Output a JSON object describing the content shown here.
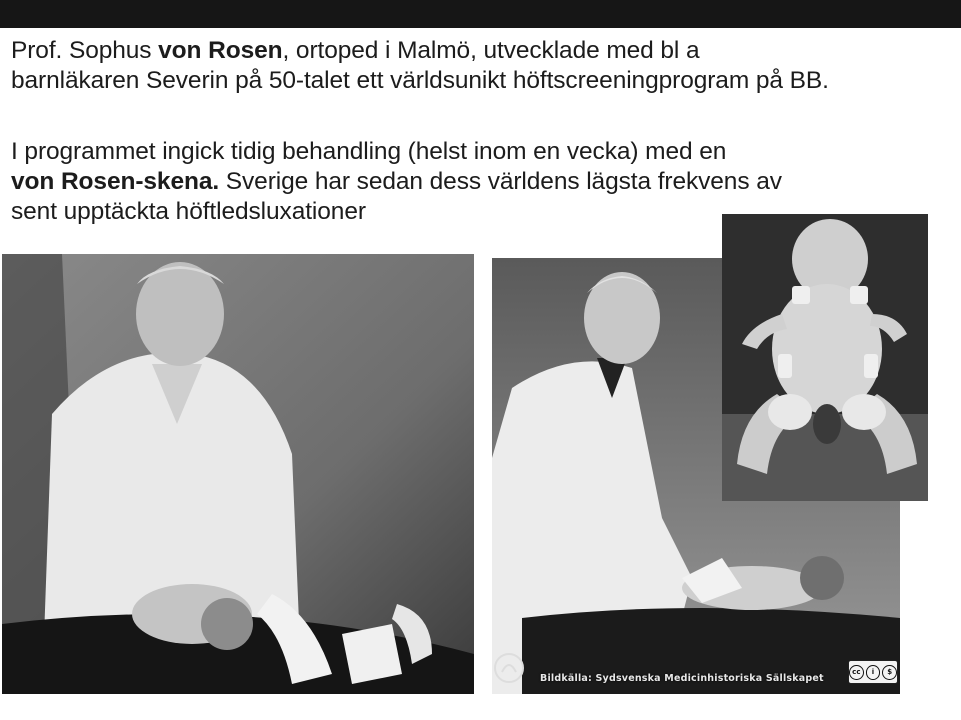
{
  "slide": {
    "paragraph1": {
      "before": "Prof. Sophus ",
      "bold": "von Rosen",
      "after": ", ortoped i Malmö, utvecklade med bl a\nbarnläkaren Severin på 50-talet ett världsunikt höftscreeningprogram på BB."
    },
    "paragraph2": {
      "before": "I programmet ingick tidig behandling (helst inom en vecka) med en\n",
      "bold": "von Rosen-skena.",
      "after": " Sverige har sedan dess världens lägsta frekvens av\nsent upptäckta höftledsluxationer"
    }
  },
  "photos": {
    "credit": "Bildkälla: Sydsvenska Medicinhistoriska Sällskapet",
    "license_badge": "cc-by-nc-icon"
  }
}
